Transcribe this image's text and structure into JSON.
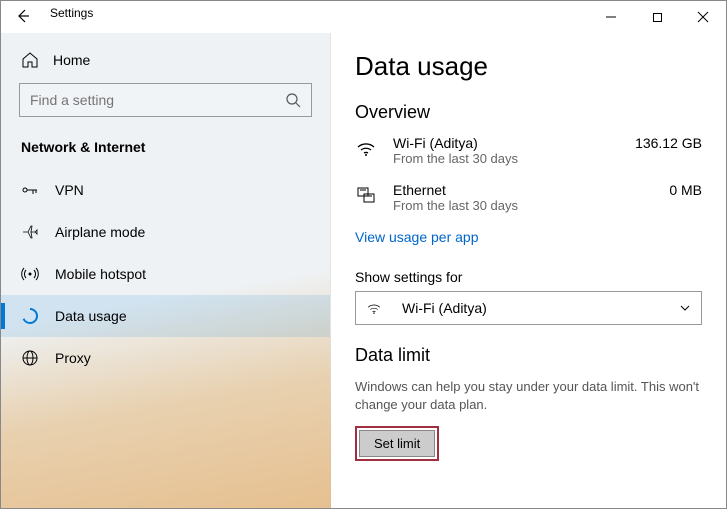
{
  "window": {
    "title": "Settings"
  },
  "sidebar": {
    "home_label": "Home",
    "search_placeholder": "Find a setting",
    "section_title": "Network & Internet",
    "items": [
      {
        "label": "VPN"
      },
      {
        "label": "Airplane mode"
      },
      {
        "label": "Mobile hotspot"
      },
      {
        "label": "Data usage"
      },
      {
        "label": "Proxy"
      }
    ]
  },
  "content": {
    "page_title": "Data usage",
    "overview_heading": "Overview",
    "usage": [
      {
        "name": "Wi-Fi (Aditya)",
        "sub": "From the last 30 days",
        "value": "136.12 GB"
      },
      {
        "name": "Ethernet",
        "sub": "From the last 30 days",
        "value": "0 MB"
      }
    ],
    "view_per_app": "View usage per app",
    "show_settings_label": "Show settings for",
    "dropdown_value": "Wi-Fi (Aditya)",
    "data_limit_heading": "Data limit",
    "data_limit_desc": "Windows can help you stay under your data limit. This won't change your data plan.",
    "set_limit_label": "Set limit"
  }
}
